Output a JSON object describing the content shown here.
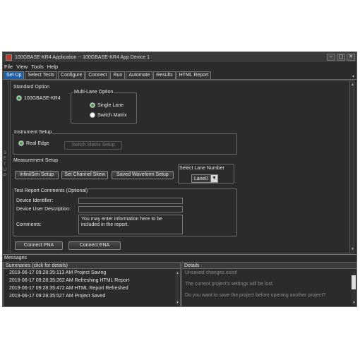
{
  "window": {
    "title": "100GBASE-KR4 Application -- 100GBASE-KR4 App Device 1"
  },
  "window_buttons": {
    "minimize": "–",
    "maximize": "▢",
    "close": "✕"
  },
  "menu": [
    "File",
    "View",
    "Tools",
    "Help"
  ],
  "tabs": [
    "Set Up",
    "Select Tests",
    "Configure",
    "Connect",
    "Run",
    "Automate",
    "Results",
    "HTML Report"
  ],
  "active_tab": "Set Up",
  "side_strip": [
    "S",
    "E",
    "T",
    "U",
    "P"
  ],
  "standard_option": {
    "label": "Standard Option",
    "option": "100GBASE-KR4",
    "multi_lane": {
      "label": "Multi-Lane Option",
      "single_lane": "Single Lane",
      "switch_matrix": "Switch Matrix"
    }
  },
  "instrument_setup": {
    "label": "Instrument Setup",
    "real_edge": "Real Edge",
    "switch_matrix_setup": "Switch Matrix Setup"
  },
  "measurement_setup": {
    "label": "Measurement Setup",
    "infinisim": "InfiniiSim Setup",
    "channel_skew": "Set Channel Skew",
    "saved_waveform": "Saved Waveform Setup",
    "lane_label": "Select Lane Number",
    "lane_value": "Lane0"
  },
  "test_report": {
    "label": "Test Report Comments (Optional)",
    "device_identifier": "Device Identifier:",
    "device_user_description": "Device User Description:",
    "comments": "Comments:",
    "comments_value": "You may enter information here to be included in the report."
  },
  "connect_pna": "Connect PNA",
  "connect_ena": "Connect ENA",
  "messages": {
    "label": "Messages",
    "summaries_header": "Summaries (click for details)",
    "details_header": "Details",
    "summaries": [
      "2019-06-17 09:28:35:113 AM Project Saving",
      "2019-06-17 09:28:35:262 AM Refreshing HTML Report",
      "2019-06-17 09:28:35:472 AM HTML Report Refreshed",
      "2019-06-17 09:28:35:527 AM Project Saved"
    ],
    "details": [
      "Unsaved changes exist!",
      "The current project's settings will be lost.",
      "Do you want to save the project before opening another project?"
    ]
  },
  "colors": {
    "active_tab": "#1f5fa8",
    "background": "#2b2b2b",
    "radio_selected": "#2ea043"
  },
  "icons": [
    "app-icon",
    "chevron-down-icon",
    "scroll-up-icon",
    "scroll-down-icon"
  ]
}
